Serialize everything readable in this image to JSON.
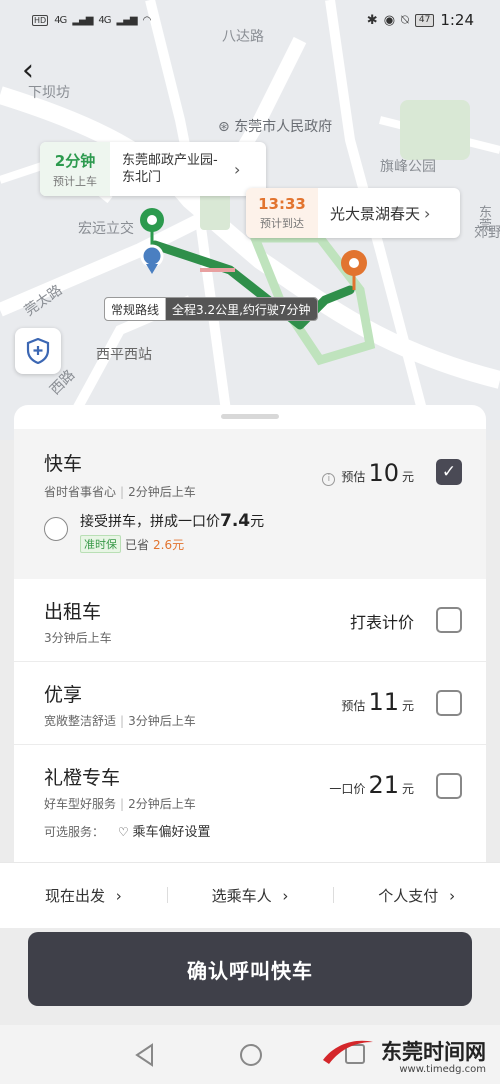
{
  "status_bar": {
    "hd1": "HD",
    "hd2": "HD",
    "net1": "4G",
    "net2": "4G",
    "battery": "47",
    "time": "1:24"
  },
  "map": {
    "labels": [
      "八达路",
      "下坝坊",
      "东莞市人民政府",
      "旗峰公园",
      "宏远立交",
      "莞太路",
      "西平西站",
      "东莞",
      "郊野",
      "西路"
    ],
    "pickup": {
      "eta": "2分钟",
      "eta_label": "预计上车",
      "place": "东莞邮政产业园-东北门"
    },
    "dropoff": {
      "time": "13:33",
      "time_label": "预计到达",
      "place": "光大景湖春天"
    },
    "route": {
      "type": "常规路线",
      "summary": "全程3.2公里,约行驶7分钟"
    }
  },
  "rides": {
    "kuaiche": {
      "name": "快车",
      "tag1": "省时省事省心",
      "tag2": "2分钟后上车",
      "price_prefix": "预估",
      "price": "10",
      "unit": "元",
      "carpool_text": "接受拼车，拼成一口价",
      "carpool_price": "7.4",
      "carpool_unit": "元",
      "badge": "准时保",
      "save_prefix": "已省",
      "save": "2.6元"
    },
    "taxi": {
      "name": "出租车",
      "tag1": "3分钟后上车",
      "price_text": "打表计价"
    },
    "youxiang": {
      "name": "优享",
      "tag1": "宽敞整洁舒适",
      "tag2": "3分钟后上车",
      "price_prefix": "预估",
      "price": "11",
      "unit": "元"
    },
    "licheng": {
      "name": "礼橙专车",
      "tag1": "好车型好服务",
      "tag2": "2分钟后上车",
      "price_prefix": "一口价",
      "price": "21",
      "unit": "元",
      "service_label": "可选服务：",
      "service": "乘车偏好设置"
    }
  },
  "options": {
    "depart": "现在出发",
    "passenger": "选乘车人",
    "payment": "个人支付"
  },
  "confirm_label": "确认呼叫快车",
  "watermark": {
    "name": "东莞时间网",
    "url": "www.timedg.com"
  },
  "colors": {
    "green": "#2c9a4e",
    "orange": "#e2742f",
    "dark_button": "#3f4049"
  }
}
